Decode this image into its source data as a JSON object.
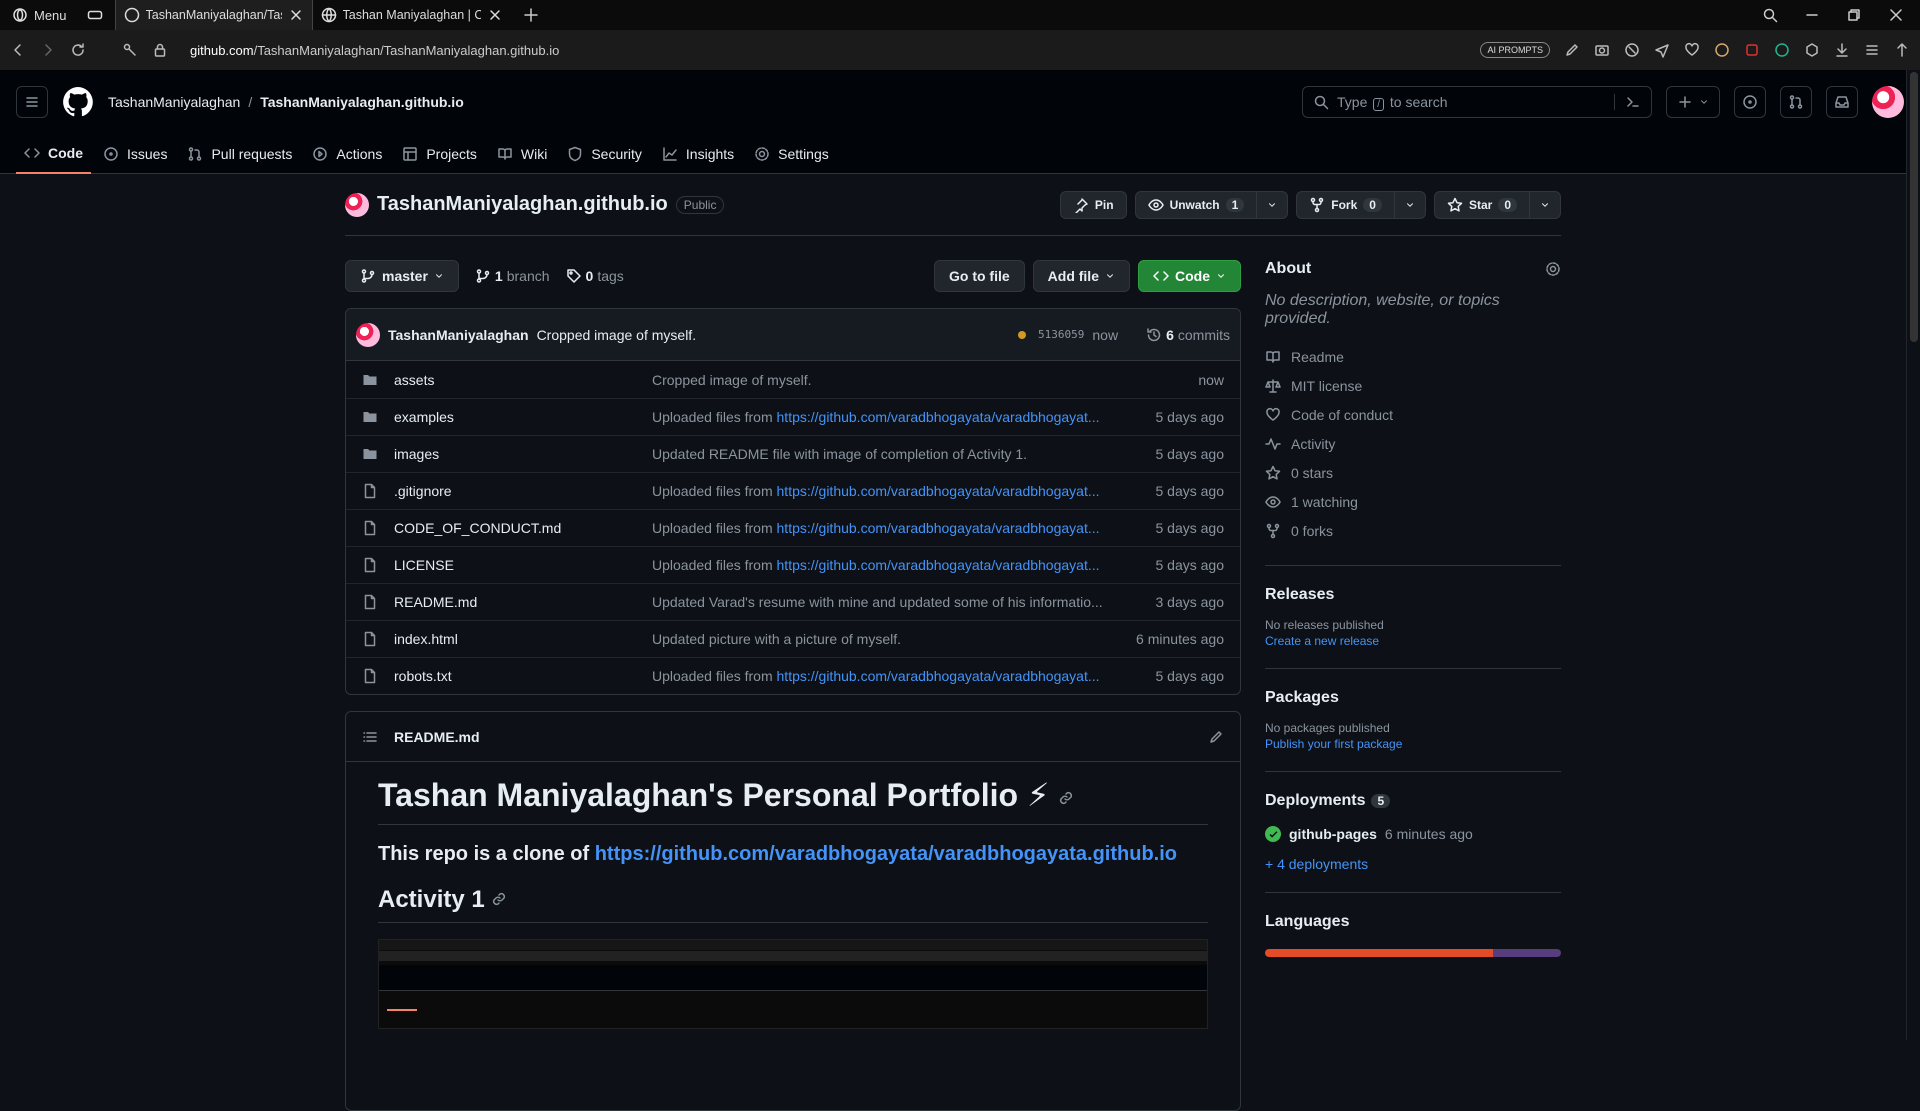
{
  "browser": {
    "menu_label": "Menu",
    "tabs": [
      {
        "label": "TashanManiyalaghan/Tasha"
      },
      {
        "label": "Tashan Maniyalaghan | Con"
      }
    ],
    "url_domain": "github.com",
    "url_path": "/TashanManiyalaghan/TashanManiyalaghan.github.io",
    "ai_prompts": "AI PROMPTS"
  },
  "header": {
    "owner": "TashanManiyalaghan",
    "separator": "/",
    "repo": "TashanManiyalaghan.github.io",
    "search_pre": "Type",
    "search_key": "/",
    "search_post": "to search"
  },
  "repo_tabs": [
    {
      "label": "Code"
    },
    {
      "label": "Issues"
    },
    {
      "label": "Pull requests"
    },
    {
      "label": "Actions"
    },
    {
      "label": "Projects"
    },
    {
      "label": "Wiki"
    },
    {
      "label": "Security"
    },
    {
      "label": "Insights"
    },
    {
      "label": "Settings"
    }
  ],
  "repo": {
    "name": "TashanManiyalaghan.github.io",
    "visibility": "Public",
    "pin": "Pin",
    "unwatch": "Unwatch",
    "unwatch_count": "1",
    "fork": "Fork",
    "fork_count": "0",
    "star": "Star",
    "star_count": "0"
  },
  "branch": {
    "name": "master",
    "branch_count": "1",
    "branch_label": "branch",
    "tag_count": "0",
    "tag_label": "tags",
    "goto": "Go to file",
    "add_file": "Add file",
    "code": "Code"
  },
  "commit": {
    "author": "TashanManiyalaghan",
    "message": "Cropped image of myself.",
    "sha": "5136059",
    "time": "now",
    "count": "6",
    "count_label": "commits"
  },
  "files": [
    {
      "name": "assets",
      "type": "dir",
      "msg": "Cropped image of myself.",
      "link": "",
      "time": "now"
    },
    {
      "name": "examples",
      "type": "dir",
      "msg": "Uploaded files from ",
      "link": "https://github.com/varadbhogayata/varadbhogayat...",
      "time": "5 days ago"
    },
    {
      "name": "images",
      "type": "dir",
      "msg": "Updated README file with image of completion of Activity 1.",
      "link": "",
      "time": "5 days ago"
    },
    {
      "name": ".gitignore",
      "type": "file",
      "msg": "Uploaded files from ",
      "link": "https://github.com/varadbhogayata/varadbhogayat...",
      "time": "5 days ago"
    },
    {
      "name": "CODE_OF_CONDUCT.md",
      "type": "file",
      "msg": "Uploaded files from ",
      "link": "https://github.com/varadbhogayata/varadbhogayat...",
      "time": "5 days ago"
    },
    {
      "name": "LICENSE",
      "type": "file",
      "msg": "Uploaded files from ",
      "link": "https://github.com/varadbhogayata/varadbhogayat...",
      "time": "5 days ago"
    },
    {
      "name": "README.md",
      "type": "file",
      "msg": "Updated Varad's resume with mine and updated some of his informatio...",
      "link": "",
      "time": "3 days ago"
    },
    {
      "name": "index.html",
      "type": "file",
      "msg": "Updated picture with a picture of myself.",
      "link": "",
      "time": "6 minutes ago"
    },
    {
      "name": "robots.txt",
      "type": "file",
      "msg": "Uploaded files from ",
      "link": "https://github.com/varadbhogayata/varadbhogayat...",
      "time": "5 days ago"
    }
  ],
  "readme": {
    "file": "README.md",
    "h1": "Tashan Maniyalaghan's Personal Portfolio ⚡",
    "clone_text": "This repo is a clone of ",
    "clone_link": "https://github.com/varadbhogayata/varadbhogayata.github.io",
    "h2": "Activity 1"
  },
  "about": {
    "title": "About",
    "desc": "No description, website, or topics provided.",
    "items": [
      {
        "icon": "book-icon",
        "label": "Readme"
      },
      {
        "icon": "scale-icon",
        "label": "MIT license"
      },
      {
        "icon": "heart-icon",
        "label": "Code of conduct"
      },
      {
        "icon": "pulse-icon",
        "label": "Activity"
      },
      {
        "icon": "star-icon",
        "label": "0 stars"
      },
      {
        "icon": "eye-icon",
        "label": "1 watching"
      },
      {
        "icon": "fork-icon",
        "label": "0 forks"
      }
    ]
  },
  "releases": {
    "title": "Releases",
    "none": "No releases published",
    "link": "Create a new release"
  },
  "packages": {
    "title": "Packages",
    "none": "No packages published",
    "link": "Publish your first package"
  },
  "deployments": {
    "title": "Deployments",
    "count": "5",
    "env": "github-pages",
    "time": "6 minutes ago",
    "more": "+ 4 deployments"
  },
  "languages": {
    "title": "Languages",
    "bars": [
      {
        "color": "#e34c26",
        "share": 0.77
      },
      {
        "color": "#563d7c",
        "share": 0.23
      }
    ]
  },
  "colors": {
    "accent": "#f78166",
    "link": "#4493f8",
    "green": "#238636"
  }
}
